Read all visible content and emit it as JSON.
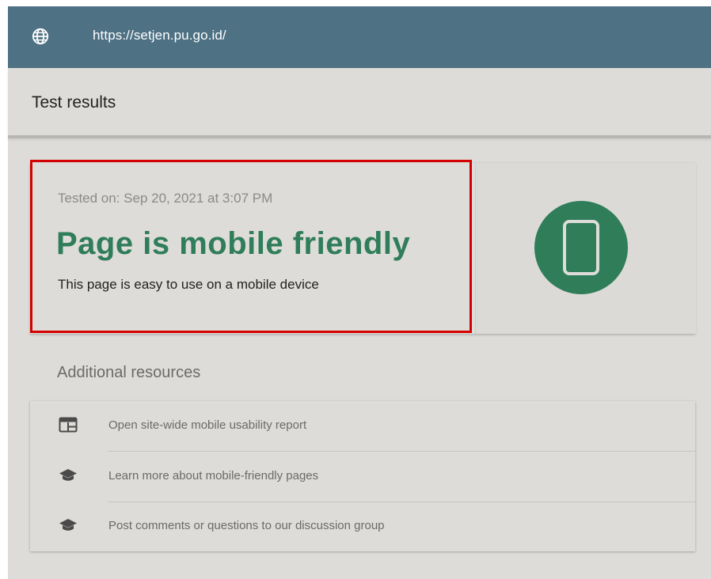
{
  "url_bar": {
    "url": "https://setjen.pu.go.id/",
    "icon": "globe-icon"
  },
  "header": {
    "title": "Test results"
  },
  "result": {
    "tested_on": "Tested on: Sep 20, 2021 at 3:07 PM",
    "verdict": "Page is mobile friendly",
    "description": "This page is easy to use on a mobile device",
    "icon": "mobile-phone-icon",
    "accent_color": "#2f7d59",
    "highlight_color": "#d40000"
  },
  "resources": {
    "heading": "Additional resources",
    "items": [
      {
        "label": "Open site-wide mobile usability report",
        "icon": "report-icon"
      },
      {
        "label": "Learn more about mobile-friendly pages",
        "icon": "graduation-cap-icon"
      },
      {
        "label": "Post comments or questions to our discussion group",
        "icon": "graduation-cap-icon"
      }
    ]
  },
  "colors": {
    "url_bar_bg": "#4e7184",
    "page_bg": "#dedcd8"
  }
}
